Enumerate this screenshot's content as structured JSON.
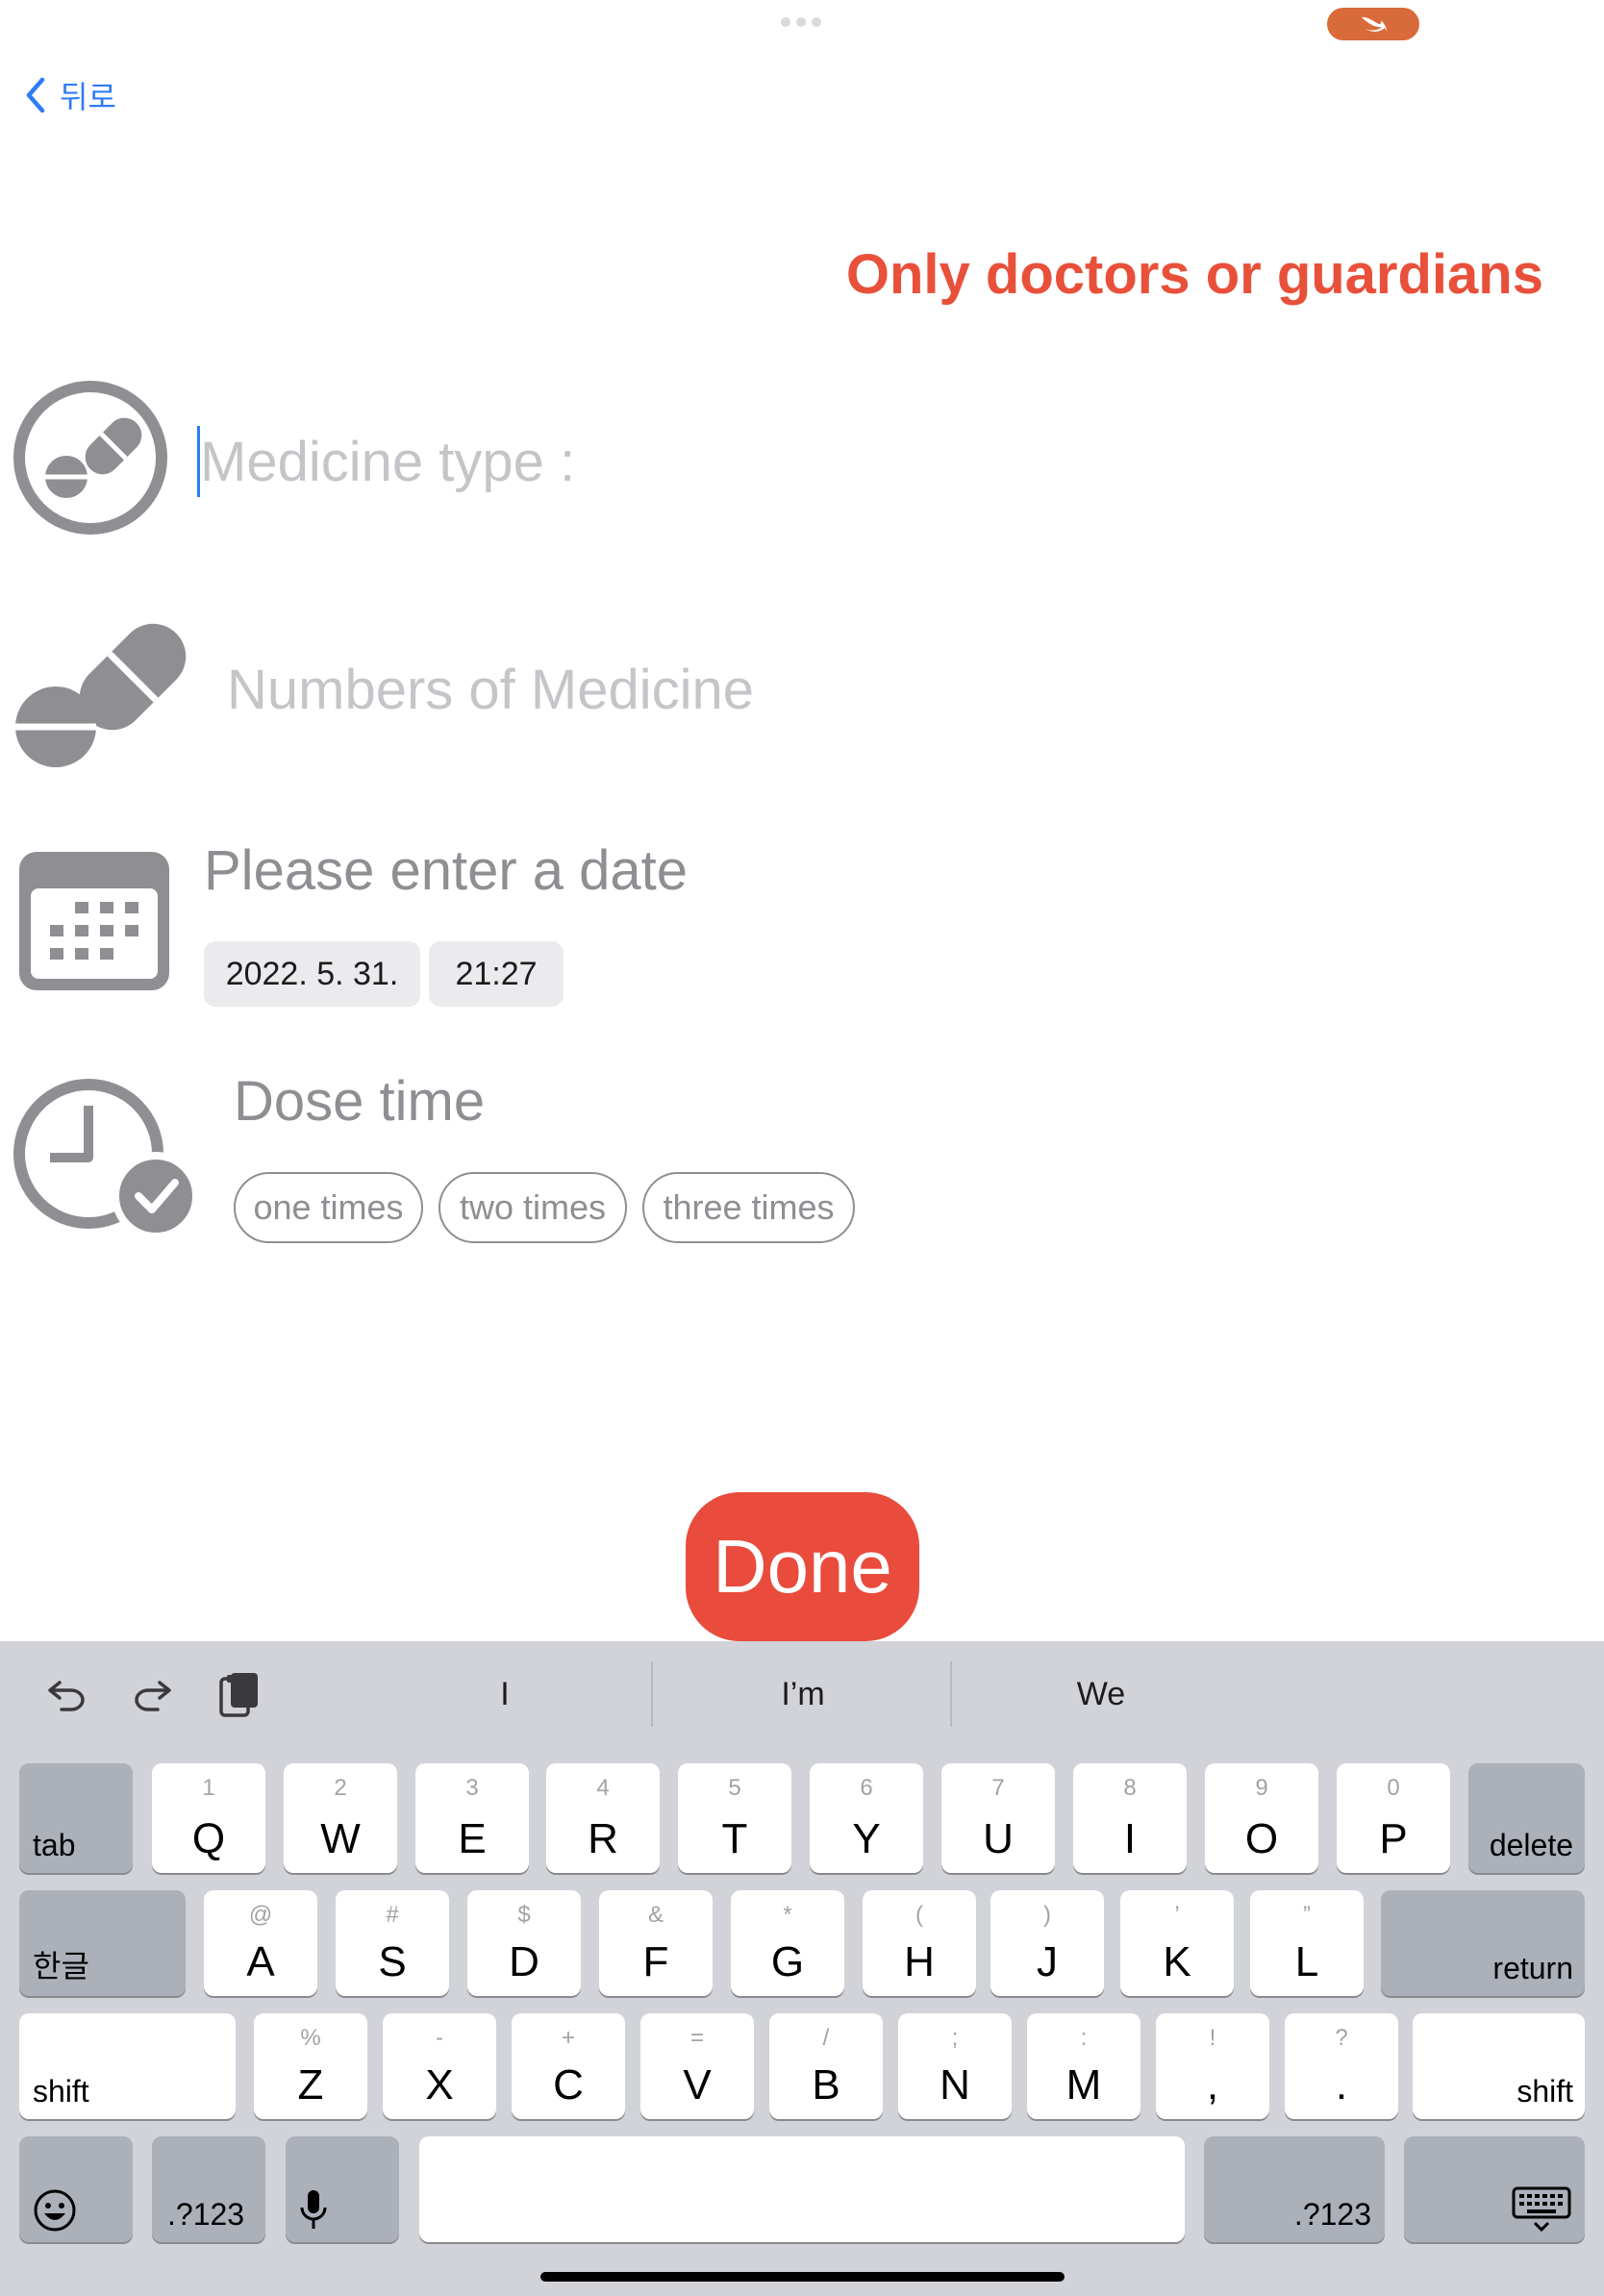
{
  "nav": {
    "back_label": "뒤로"
  },
  "warning": "Only doctors or guardians",
  "form": {
    "medicine_type_placeholder": "Medicine type :",
    "numbers_placeholder": "Numbers of Medicine",
    "date_label": "Please enter a date",
    "date_value": "2022. 5. 31.",
    "time_value": "21:27",
    "dose_label": "Dose time",
    "dose_options": [
      "one times",
      "two times",
      "three times"
    ]
  },
  "done_label": "Done",
  "keyboard": {
    "suggestions": [
      "I",
      "I’m",
      "We"
    ],
    "row1": [
      {
        "main": "Q",
        "sub": "1"
      },
      {
        "main": "W",
        "sub": "2"
      },
      {
        "main": "E",
        "sub": "3"
      },
      {
        "main": "R",
        "sub": "4"
      },
      {
        "main": "T",
        "sub": "5"
      },
      {
        "main": "Y",
        "sub": "6"
      },
      {
        "main": "U",
        "sub": "7"
      },
      {
        "main": "I",
        "sub": "8"
      },
      {
        "main": "O",
        "sub": "9"
      },
      {
        "main": "P",
        "sub": "0"
      }
    ],
    "row2": [
      {
        "main": "A",
        "sub": "@"
      },
      {
        "main": "S",
        "sub": "#"
      },
      {
        "main": "D",
        "sub": "$"
      },
      {
        "main": "F",
        "sub": "&"
      },
      {
        "main": "G",
        "sub": "*"
      },
      {
        "main": "H",
        "sub": "("
      },
      {
        "main": "J",
        "sub": ")"
      },
      {
        "main": "K",
        "sub": "’"
      },
      {
        "main": "L",
        "sub": "”"
      }
    ],
    "row3": [
      {
        "main": "Z",
        "sub": "%"
      },
      {
        "main": "X",
        "sub": "-"
      },
      {
        "main": "C",
        "sub": "+"
      },
      {
        "main": "V",
        "sub": "="
      },
      {
        "main": "B",
        "sub": "/"
      },
      {
        "main": "N",
        "sub": ";"
      },
      {
        "main": "M",
        "sub": ":"
      },
      {
        "main": ",",
        "sub": "!"
      },
      {
        "main": ".",
        "sub": "?"
      }
    ],
    "tab": "tab",
    "delete": "delete",
    "korean": "한글",
    "return": "return",
    "shift": "shift",
    "numbers": ".?123"
  },
  "colors": {
    "accent": "#2f7bf6",
    "warning": "#e8503a",
    "done": "#e94b3c",
    "swift_pill": "#d96a3a"
  },
  "icons": [
    "pill-circle-icon",
    "pills-icon",
    "calendar-icon",
    "clock-check-icon",
    "undo-icon",
    "redo-icon",
    "paste-icon",
    "emoji-icon",
    "microphone-icon",
    "keyboard-dismiss-icon",
    "swift-icon"
  ]
}
